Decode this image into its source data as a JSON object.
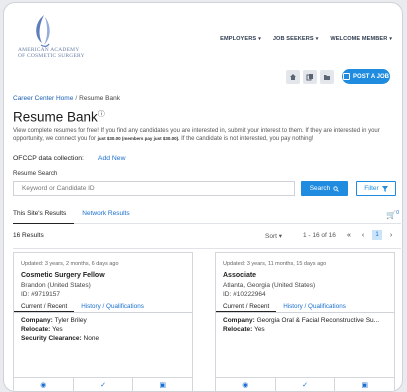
{
  "header": {
    "org_name_line1": "AMERICAN ACADEMY",
    "org_name_line2": "OF COSMETIC SURGERY",
    "nav": [
      {
        "label": "EMPLOYERS"
      },
      {
        "label": "JOB SEEKERS"
      },
      {
        "label": "WELCOME MEMBER"
      }
    ]
  },
  "toolbar": {
    "post_job_label": "POST A JOB"
  },
  "breadcrumb": {
    "home": "Career Center Home",
    "separator": "/",
    "current": "Resume Bank"
  },
  "page": {
    "title": "Resume Bank",
    "info_glyph": "ⓘ",
    "intro_part1": "View complete resumes for free! If you find any candidates you are interested in, submit your interest to them. If they are interested in your opportunity, we connect you for",
    "intro_small": "just $30.00 (members pay just $30.00).",
    "intro_part2": "If the candidate is not interested, you pay nothing!"
  },
  "ofccp": {
    "label": "OFCCP data collection:",
    "add_new": "Add New"
  },
  "search": {
    "label": "Resume Search",
    "placeholder": "Keyword or Candidate ID",
    "button": "Search",
    "filter": "Filter"
  },
  "tabs": [
    {
      "label": "This Site's Results"
    },
    {
      "label": "Network Results"
    }
  ],
  "cart": {
    "count": "0"
  },
  "results": {
    "count": "16 Results",
    "sort": "Sort",
    "range": "1 - 16 of 16",
    "first": "«",
    "prev": "‹",
    "page": "1",
    "next": "›",
    "last": "»"
  },
  "cards": [
    {
      "updated": "Updated: 3 years, 2 months, 6 days ago",
      "title": "Cosmetic Surgery Fellow",
      "location": "Brandon (United States)",
      "id": "ID: #9719157",
      "tab_current": "Current / Recent",
      "tab_history": "History / Qualifications",
      "company_label": "Company:",
      "company": "Tyler Briley",
      "relocate_label": "Relocate:",
      "relocate": "Yes",
      "clearance_label": "Security Clearance:",
      "clearance": "None"
    },
    {
      "updated": "Updated: 3 years, 11 months, 15 days ago",
      "title": "Associate",
      "location": "Atlanta, Georgia (United States)",
      "id": "ID: #10222964",
      "tab_current": "Current / Recent",
      "tab_history": "History / Qualifications",
      "company_label": "Company:",
      "company": "Georgia Oral & Facial Reconstructive Su...",
      "relocate_label": "Relocate:",
      "relocate": "Yes"
    }
  ],
  "colors": {
    "accent": "#1f8ce0",
    "link": "#1a6fd0"
  },
  "icons": {
    "home": "home-icon",
    "copy": "copy-icon",
    "folder": "folder-icon",
    "search": "search-icon",
    "filter": "filter-icon",
    "cart": "cart-icon"
  }
}
